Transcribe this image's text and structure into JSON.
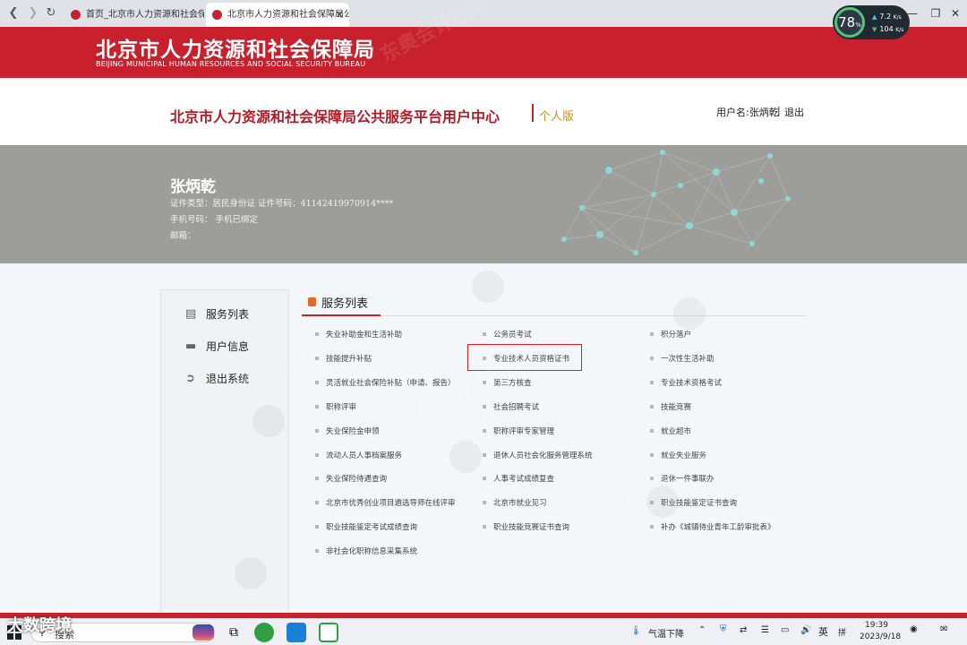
{
  "browser": {
    "tabs": [
      {
        "label": "首页_北京市人力资源和社会保障局"
      },
      {
        "label": "北京市人力资源和社会保障局公"
      }
    ]
  },
  "speed": {
    "percent": "78",
    "unit": "%",
    "up": "7.2",
    "down": "104",
    "rate_unit": "K/s"
  },
  "header": {
    "title_cn": "北京市人力资源和社会保障局",
    "title_en": "BEIJING MUNICIPAL HUMAN RESOURCES AND SOCIAL SECURITY BUREAU"
  },
  "titlebar": {
    "platform_title": "北京市人力资源和社会保障局公共服务平台用户中心",
    "edition": "个人版",
    "username": "用户名:张炳乾",
    "separator": "|",
    "logout": "退出"
  },
  "profile": {
    "name": "张炳乾",
    "id_line": "证件类型：居民身份证  证件号码：41142419970914****",
    "phone_line": "手机号码：  手机已绑定",
    "email_line": "邮箱："
  },
  "sidebar": {
    "items": [
      {
        "label": "服务列表",
        "icon": "list-icon"
      },
      {
        "label": "用户信息",
        "icon": "id-card-icon"
      },
      {
        "label": "退出系统",
        "icon": "exit-icon"
      }
    ]
  },
  "services": {
    "header": "服务列表",
    "col1": [
      "失业补助金和生活补助",
      "技能提升补贴",
      "灵活就业社会保险补贴（申请、报告）",
      "职称评审",
      "失业保险金申领",
      "流动人员人事档案服务",
      "失业保险待遇查询",
      "北京市优秀创业项目遴选导师在线评审",
      "职业技能鉴定考试成绩查询",
      "非社会化职称信息采集系统"
    ],
    "col2": [
      "公务员考试",
      "专业技术人员资格证书",
      "第三方核查",
      "社会招聘考试",
      "职称评审专家管理",
      "退休人员社会化服务管理系统",
      "人事考试成绩复查",
      "北京市就业见习",
      "职业技能竞赛证书查询"
    ],
    "col3": [
      "积分落户",
      "一次性生活补助",
      "专业技术资格考试",
      "技能竞赛",
      "就业超市",
      "就业失业服务",
      "退休一件事联办",
      "职业技能鉴定证书查询",
      "补办《城镇待业青年工龄审批表》"
    ]
  },
  "taskbar": {
    "search_text": "搜索",
    "weather": "气温下降",
    "ime": "英",
    "ime2": "拼",
    "time": "19:39",
    "date": "2023/9/18",
    "overlay": "大数跨境"
  },
  "colors": {
    "brand_red": "#c8202c",
    "title_red": "#b31b27",
    "edition_gold": "#d0902a",
    "profile_gray": "#9d9d9a",
    "highlight_red": "#e21d1d"
  }
}
